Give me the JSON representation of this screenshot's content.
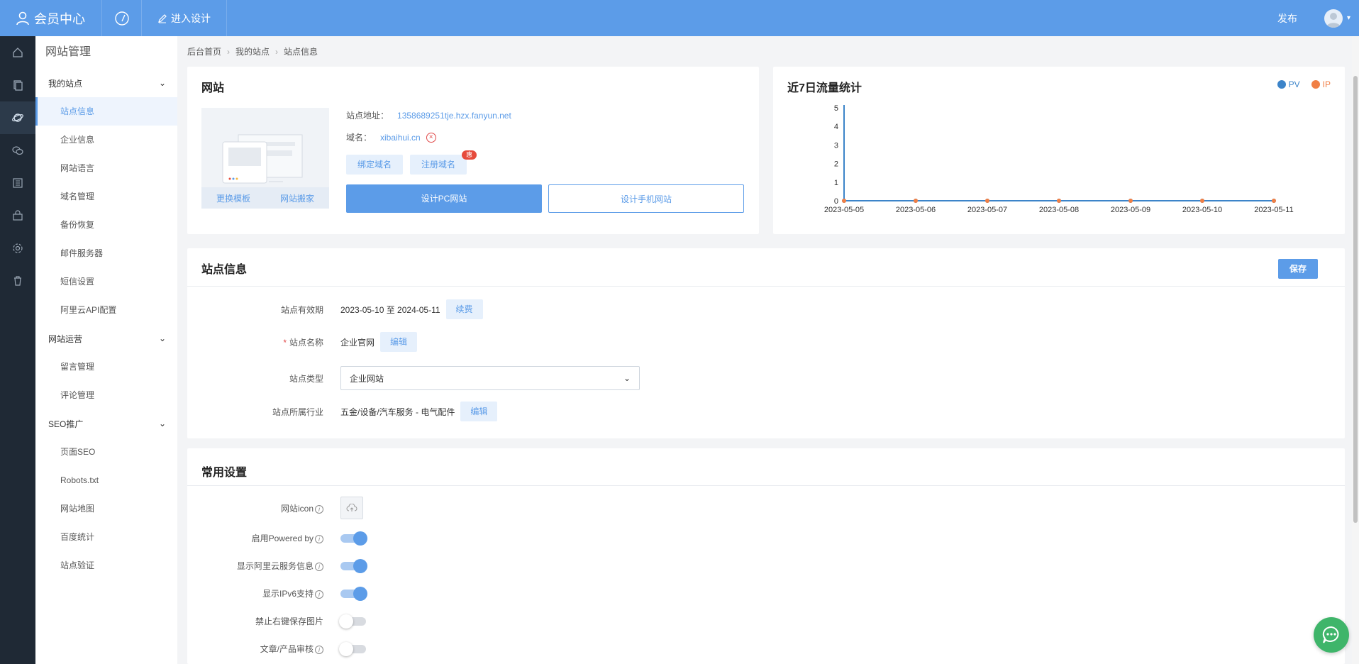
{
  "topbar": {
    "brand": "会员中心",
    "design": "进入设计",
    "publish": "发布"
  },
  "side": {
    "title": "网站管理",
    "groups": [
      {
        "label": "我的站点",
        "items": [
          "站点信息",
          "企业信息",
          "网站语言",
          "域名管理",
          "备份恢复",
          "邮件服务器",
          "短信设置",
          "阿里云API配置"
        ]
      },
      {
        "label": "网站运营",
        "items": [
          "留言管理",
          "评论管理"
        ]
      },
      {
        "label": "SEO推广",
        "items": [
          "页面SEO",
          "Robots.txt",
          "网站地图",
          "百度统计",
          "站点验证"
        ]
      }
    ]
  },
  "breadcrumb": [
    "后台首页",
    "我的站点",
    "站点信息"
  ],
  "website": {
    "title": "网站",
    "thumb_change": "更换模板",
    "thumb_move": "网站搬家",
    "addr_label": "站点地址：",
    "addr_value": "1358689251tje.hzx.fanyun.net",
    "domain_label": "域名：",
    "domain_value": "xibaihui.cn",
    "bind_domain": "绑定域名",
    "register_domain": "注册域名",
    "register_badge": "惠",
    "design_pc": "设计PC网站",
    "design_mobile": "设计手机网站"
  },
  "chart_data": {
    "type": "line",
    "title": "近7日流量统计",
    "x": [
      "2023-05-05",
      "2023-05-06",
      "2023-05-07",
      "2023-05-08",
      "2023-05-09",
      "2023-05-10",
      "2023-05-11"
    ],
    "series": [
      {
        "name": "PV",
        "values": [
          0,
          0,
          0,
          0,
          0,
          0,
          0
        ],
        "color": "#3c84c9"
      },
      {
        "name": "IP",
        "values": [
          0,
          0,
          0,
          0,
          0,
          0,
          0
        ],
        "color": "#f07f45"
      }
    ],
    "yticks": [
      "0",
      "1",
      "2",
      "3",
      "4",
      "5"
    ],
    "ylim": [
      0,
      5
    ],
    "legend": "top-right"
  },
  "site_info": {
    "title": "站点信息",
    "save": "保存",
    "validity_label": "站点有效期",
    "validity_value": "2023-05-10 至 2024-05-11",
    "renew": "续费",
    "name_required": "*",
    "name_label": "站点名称",
    "name_value": "企业官网",
    "edit": "编辑",
    "type_label": "站点类型",
    "type_value": "企业网站",
    "industry_label": "站点所属行业",
    "industry_value": "五金/设备/汽车服务 - 电气配件"
  },
  "common": {
    "title": "常用设置",
    "icon_label": "网站icon",
    "rows": [
      {
        "label": "启用Powered by",
        "on": true,
        "info": true
      },
      {
        "label": "显示阿里云服务信息",
        "on": true,
        "info": true
      },
      {
        "label": "显示IPv6支持",
        "on": true,
        "info": true
      },
      {
        "label": "禁止右键保存图片",
        "on": false,
        "info": false
      },
      {
        "label": "文章/产品审核",
        "on": false,
        "info": true
      }
    ]
  },
  "colors": {
    "primary": "#5c9ce8",
    "rail": "#1f2935",
    "pv": "#3c84c9",
    "ip": "#f07f45",
    "danger": "#e04848",
    "chat": "#3fb56a"
  }
}
